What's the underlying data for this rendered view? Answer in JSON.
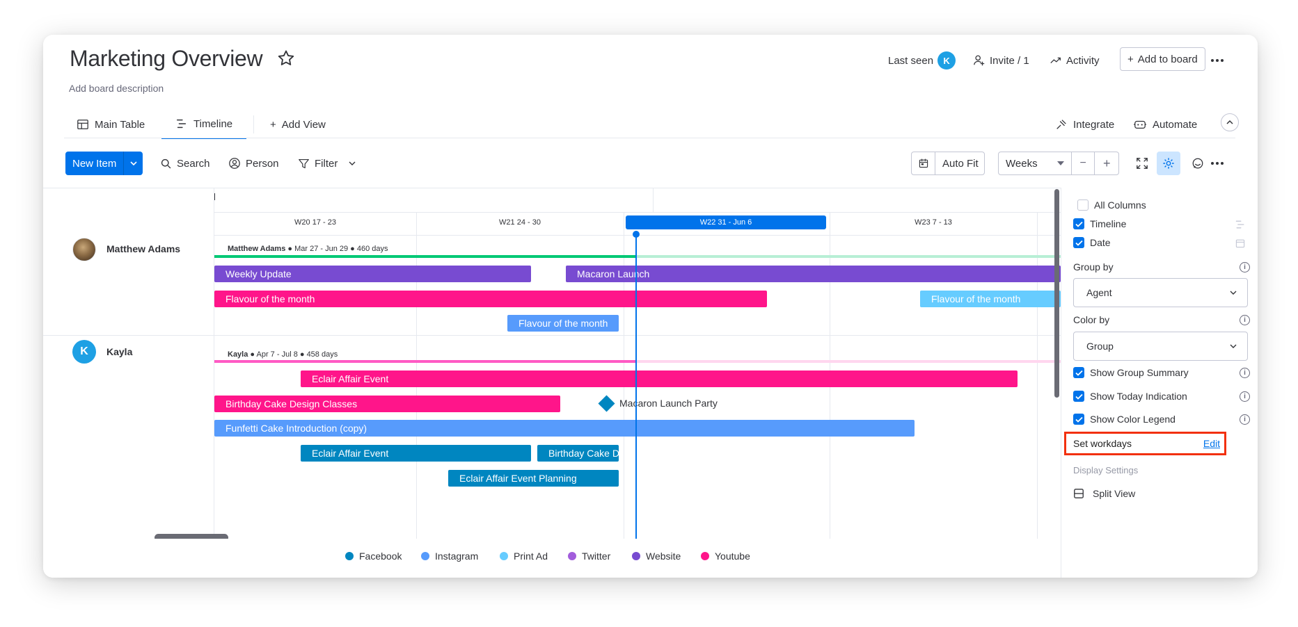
{
  "header": {
    "title": "Marketing Overview",
    "description": "Add board description",
    "last_seen_label": "Last seen",
    "last_seen_avatar": "K",
    "invite_label": "Invite / 1",
    "activity_label": "Activity",
    "add_to_board_label": "Add to board"
  },
  "tabs": {
    "main_table": "Main Table",
    "timeline": "Timeline",
    "add_view": "Add View",
    "integrate": "Integrate",
    "automate": "Automate"
  },
  "toolbar": {
    "new_item": "New Item",
    "search": "Search",
    "person": "Person",
    "filter": "Filter",
    "auto_fit": "Auto Fit",
    "scale": "Weeks",
    "minus": "−",
    "plus": "+"
  },
  "timeline": {
    "weeks": [
      {
        "label": "W20   17 - 23"
      },
      {
        "label": "W21   24 - 30"
      },
      {
        "label": "W22   31 - Jun 6",
        "active": true
      },
      {
        "label": "W23   7 - 13"
      }
    ],
    "groups": [
      {
        "name": "Matthew Adams",
        "summary_name": "Matthew Adams",
        "summary_range": " ● Mar 27 - Jun 29 ● 460 days",
        "items": [
          {
            "label": "Weekly Update",
            "color": "#784bd1"
          },
          {
            "label": "Macaron Launch",
            "color": "#784bd1"
          },
          {
            "label": "Flavour of the month",
            "color": "#ff158a"
          },
          {
            "label": "Flavour of the month",
            "color": "#66ccff"
          },
          {
            "label": "Flavour of the month",
            "color": "#579bfc"
          }
        ]
      },
      {
        "name": "Kayla",
        "avatar": "K",
        "summary_name": "Kayla",
        "summary_range": " ● Apr 7 - Jul 8 ● 458 days",
        "items": [
          {
            "label": "Eclair Affair Event",
            "color": "#ff158a"
          },
          {
            "label": "Birthday Cake Design Classes",
            "color": "#ff158a"
          },
          {
            "label": "Macaron Launch Party",
            "color": "#0086c0",
            "milestone": true
          },
          {
            "label": "Funfetti Cake Introduction (copy)",
            "color": "#579bfc"
          },
          {
            "label": "Eclair Affair Event",
            "color": "#0086c0"
          },
          {
            "label": "Birthday Cake D",
            "color": "#0086c0"
          },
          {
            "label": "Eclair Affair Event Planning",
            "color": "#0086c0"
          }
        ]
      }
    ]
  },
  "legend": [
    {
      "label": "Facebook",
      "color": "#0086c0"
    },
    {
      "label": "Instagram",
      "color": "#579bfc"
    },
    {
      "label": "Print Ad",
      "color": "#66ccff"
    },
    {
      "label": "Twitter",
      "color": "#a25ddc"
    },
    {
      "label": "Website",
      "color": "#784bd1"
    },
    {
      "label": "Youtube",
      "color": "#ff158a"
    }
  ],
  "settings_panel": {
    "all_columns": "All Columns",
    "timeline": "Timeline",
    "date": "Date",
    "group_by_label": "Group by",
    "group_by_value": "Agent",
    "color_by_label": "Color by",
    "color_by_value": "Group",
    "show_group_summary": "Show Group Summary",
    "show_today_indication": "Show Today Indication",
    "show_color_legend": "Show Color Legend",
    "set_workdays": "Set workdays",
    "edit": "Edit",
    "display_settings": "Display Settings",
    "split_view": "Split View"
  },
  "colors": {
    "accent": "#0073ea",
    "highlight": "#f2300d",
    "green_summary": "#00c875",
    "pink_summary": "#ff5ac4"
  }
}
